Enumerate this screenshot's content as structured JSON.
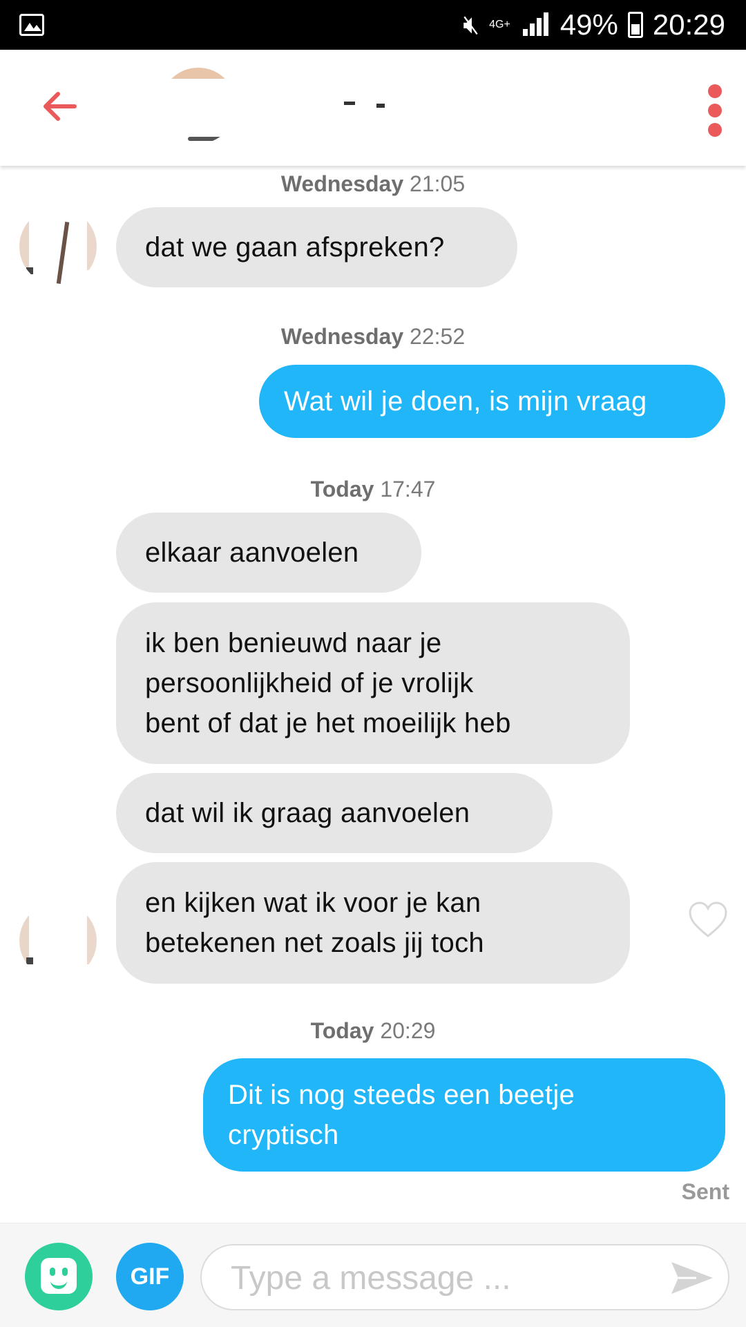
{
  "status_bar": {
    "network": "4G+",
    "battery": "49%",
    "time": "20:29",
    "icons": [
      "gallery-icon",
      "mute-icon",
      "signal-icon",
      "battery-icon"
    ]
  },
  "header": {
    "back_icon": "back-arrow-icon",
    "menu_icon": "more-vert-icon",
    "accent_color": "#ea5a5a"
  },
  "messages": [
    {
      "type": "timestamp",
      "day": "Wednesday",
      "time": "21:05"
    },
    {
      "type": "received",
      "text": "dat we gaan afspreken?"
    },
    {
      "type": "timestamp",
      "day": "Wednesday",
      "time": "22:52"
    },
    {
      "type": "sent",
      "text": "Wat wil je doen, is mijn vraag"
    },
    {
      "type": "timestamp",
      "day": "Today",
      "time": "17:47"
    },
    {
      "type": "received",
      "text": "elkaar aanvoelen"
    },
    {
      "type": "received",
      "lines": [
        "ik ben benieuwd naar je",
        "persoonlijkheid of je vrolijk",
        "bent of dat je het moeilijk heb"
      ]
    },
    {
      "type": "received",
      "text": "dat wil ik graag aanvoelen"
    },
    {
      "type": "received",
      "lines": [
        "en kijken wat ik voor je kan",
        "betekenen net zoals jij toch"
      ]
    },
    {
      "type": "timestamp",
      "day": "Today",
      "time": "20:29"
    },
    {
      "type": "sent",
      "lines": [
        "Dit is nog steeds een beetje",
        "cryptisch"
      ]
    }
  ],
  "sent_status": "Sent",
  "input_bar": {
    "gif_label": "GIF",
    "placeholder": "Type a message ...",
    "value": "",
    "sticker_icon": "sticker-icon",
    "send_icon": "send-icon"
  },
  "colors": {
    "sent_bubble": "#20b6f7",
    "received_bubble": "#e6e6e6",
    "sticker_button": "#2fcf9b",
    "gif_button": "#20a8f0"
  }
}
